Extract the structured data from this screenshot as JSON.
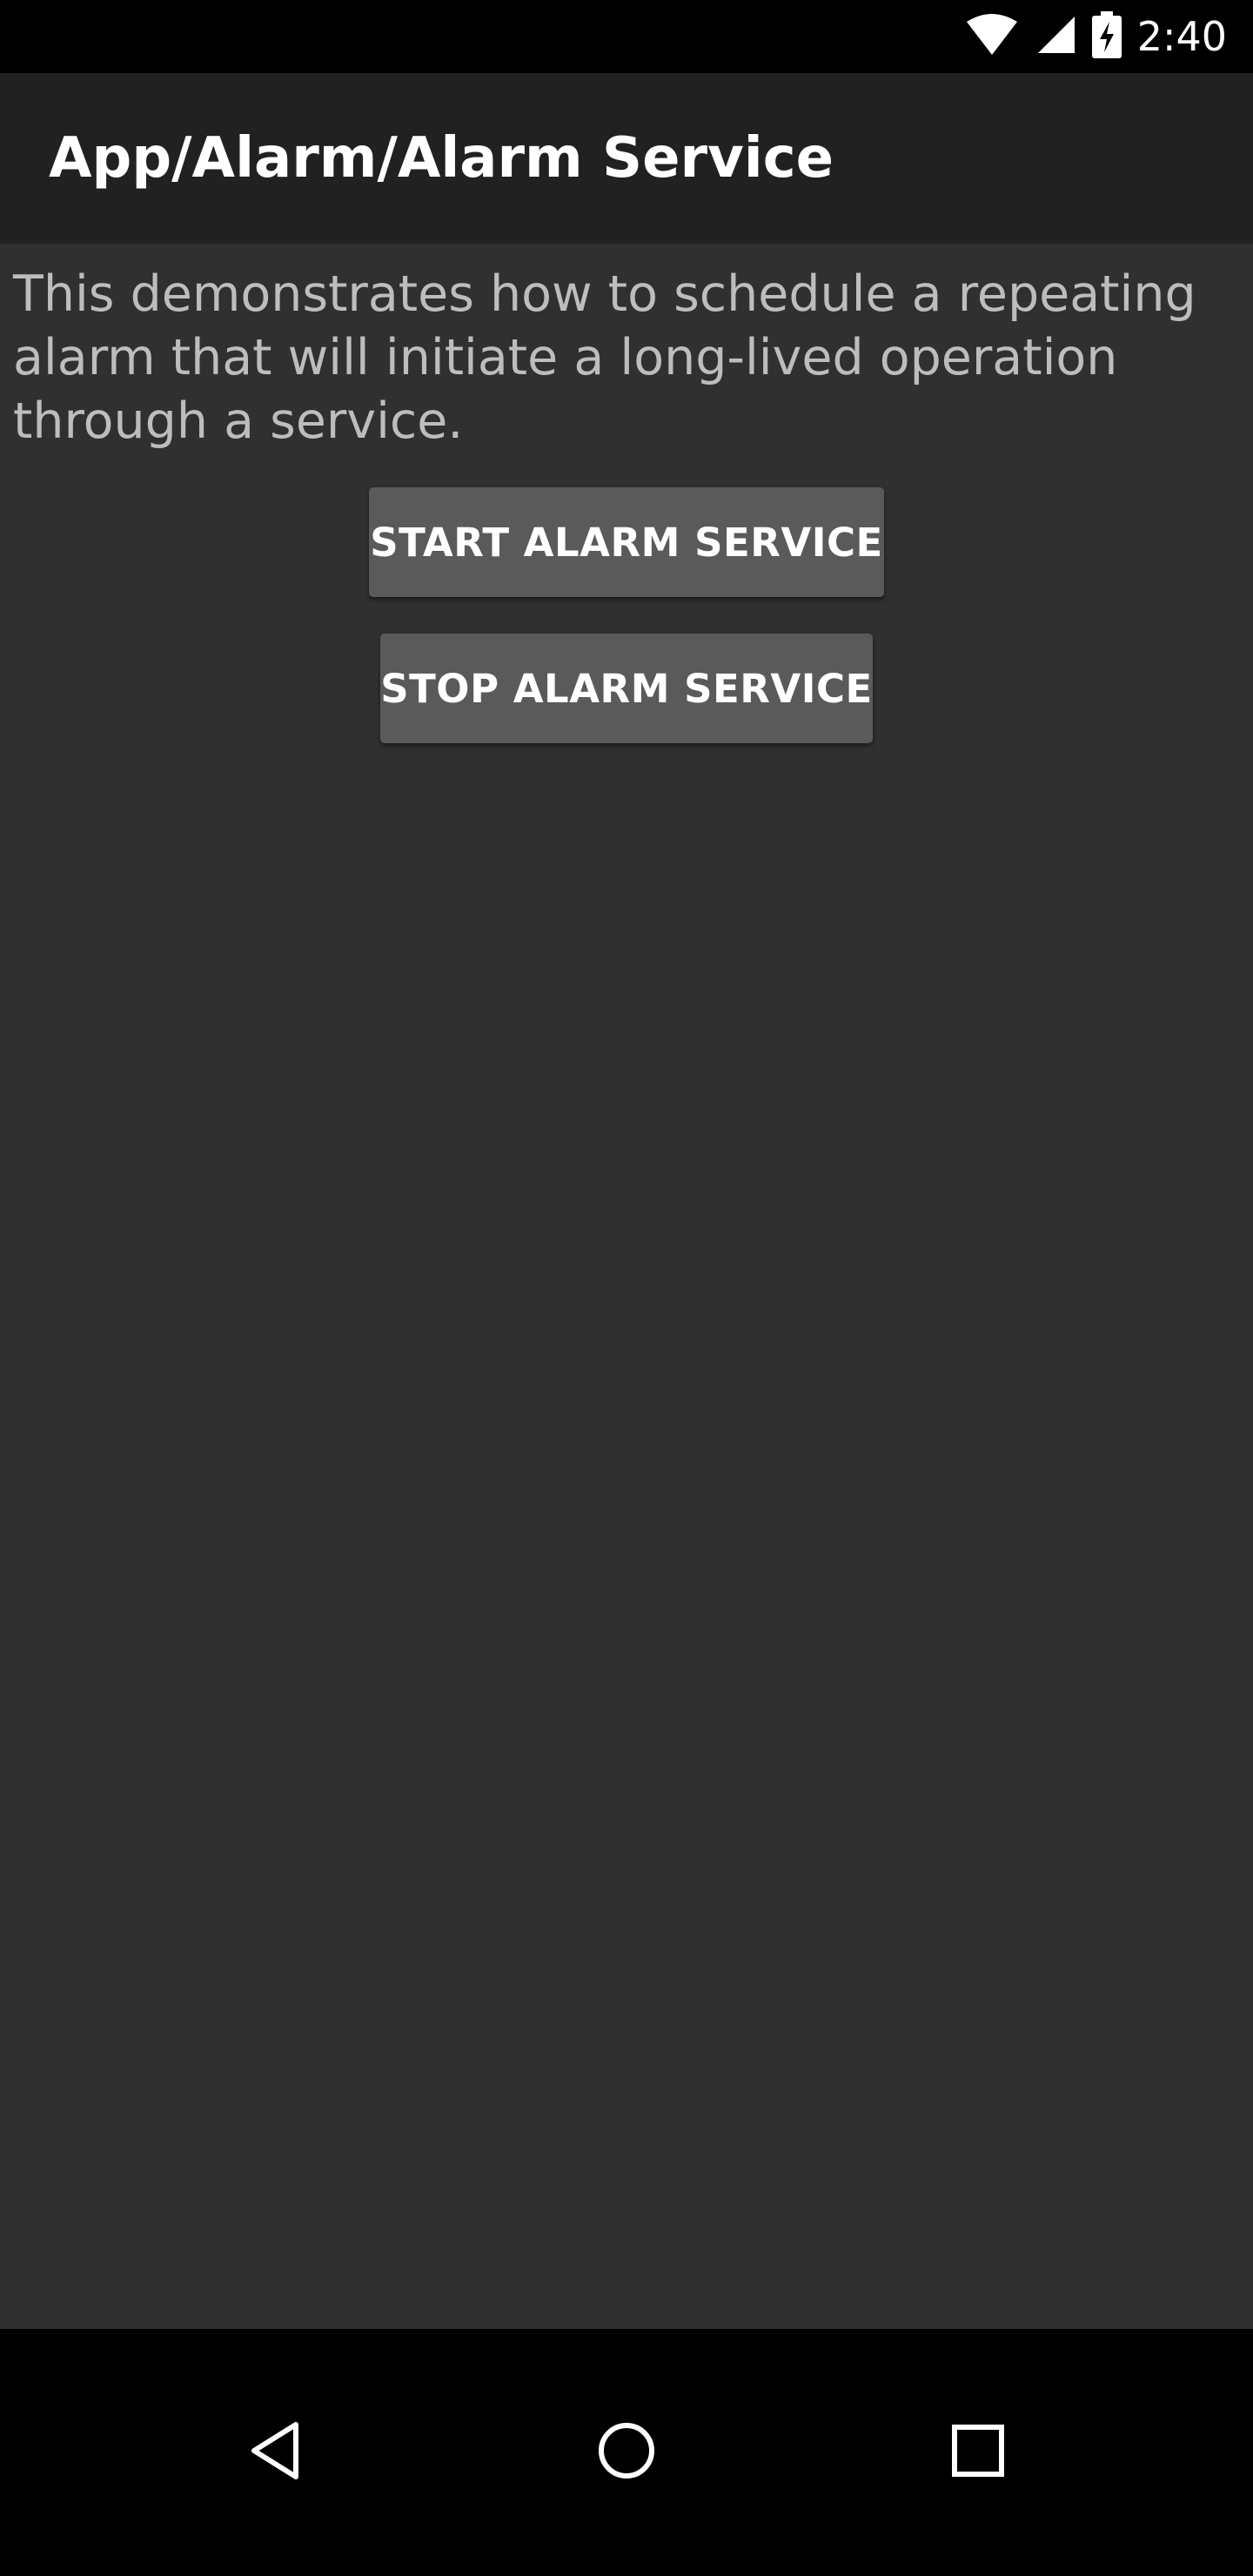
{
  "status_bar": {
    "time": "2:40",
    "icons": [
      "wifi-icon",
      "cellular-signal-icon",
      "battery-charging-icon"
    ]
  },
  "app_bar": {
    "title": "App/Alarm/Alarm Service"
  },
  "main": {
    "description": "This demonstrates how to schedule a repeating alarm that will initiate a long-lived operation through a service.",
    "start_button_label": "START ALARM SERVICE",
    "stop_button_label": "STOP ALARM SERVICE"
  },
  "nav_bar": {
    "icons": [
      "back-icon",
      "home-icon",
      "recents-icon"
    ]
  },
  "colors": {
    "background": "#303030",
    "app_bar": "#212121",
    "button": "#5a5a5a",
    "text_primary": "#ffffff",
    "text_secondary": "#bdbdbd",
    "system_bars": "#000000"
  }
}
